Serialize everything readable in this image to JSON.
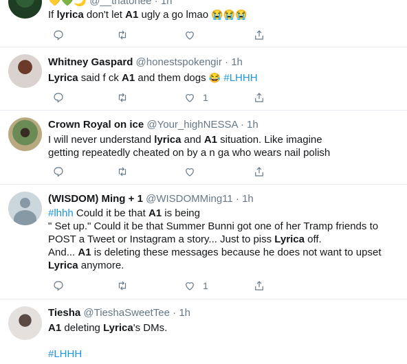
{
  "tweets": [
    {
      "name": "@__thatonee · 1h",
      "text": [
        "If ",
        "lyrica",
        " don't let ",
        "A1",
        " ugly a  go lmao ",
        "😭😭😭"
      ],
      "like_count": ""
    },
    {
      "name": "Whitney Gaspard",
      "handle": "@honestspokengir",
      "time": "1h",
      "text": [
        "Lyrica",
        " said f ck ",
        "A1",
        " and them dogs ",
        "😂",
        " #LHHH"
      ],
      "like_count": "1"
    },
    {
      "name": "Crown Royal on ice",
      "handle": "@Your_highNESSA",
      "time": "1h",
      "text": [
        "I will never understand ",
        "lyrica",
        " and ",
        "A1",
        " situation. Like imagine getting repeatedly cheated on by a n  ga who wears nail polish"
      ],
      "like_count": ""
    },
    {
      "name": "(WISDOM) Ming + 1",
      "handle": "@WISDOMMing11",
      "time": "1h",
      "text": [
        "#lhhh",
        " Could it be that ",
        "A1",
        " is being",
        "\" Set up.\" Could it be that Summer Bunni got one of her Tramp friends to POST a Tweet or Instagram a story... Just to piss ",
        "Lyrica",
        " off.",
        "And... ",
        "A1",
        " is deleting these messages because he does not want to upset ",
        "Lyrica",
        " anymore."
      ],
      "like_count": "1"
    },
    {
      "name": "Tiesha",
      "handle": "@TieshaSweetTee",
      "time": "1h",
      "text": [
        "A1",
        " deleting ",
        "Lyrica",
        "'s DMs.",
        "#LHHH"
      ]
    }
  ],
  "icons": [
    "reply-icon",
    "retweet-icon",
    "like-icon",
    "share-icon"
  ],
  "colors": {
    "link": "#1b95e0",
    "muted": "#657786",
    "border": "#e6ecf0"
  }
}
